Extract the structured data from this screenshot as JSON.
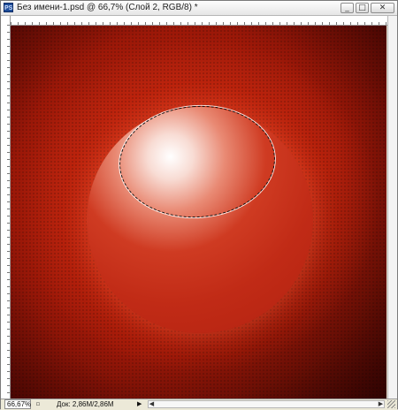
{
  "window": {
    "title": "Без имени-1.psd @ 66,7% (Слой 2, RGB/8) *",
    "app_icon": "PS",
    "app_icon_name": "photoshop-icon",
    "controls": {
      "minimize": "_",
      "maximize": "□",
      "close": "✕"
    }
  },
  "canvas": {
    "background_colors": [
      "#c92a12",
      "#9c1808",
      "#3f0402"
    ],
    "sphere_colors": [
      "#ffffff",
      "#cf3b22",
      "#b22110"
    ],
    "selection_style": "marching-ants"
  },
  "status": {
    "zoom": "66,67%",
    "doc_info": "Док: 2,86M/2,86M",
    "nav_arrow": "▶",
    "scroll_left": "◀",
    "scroll_right": "▶"
  }
}
